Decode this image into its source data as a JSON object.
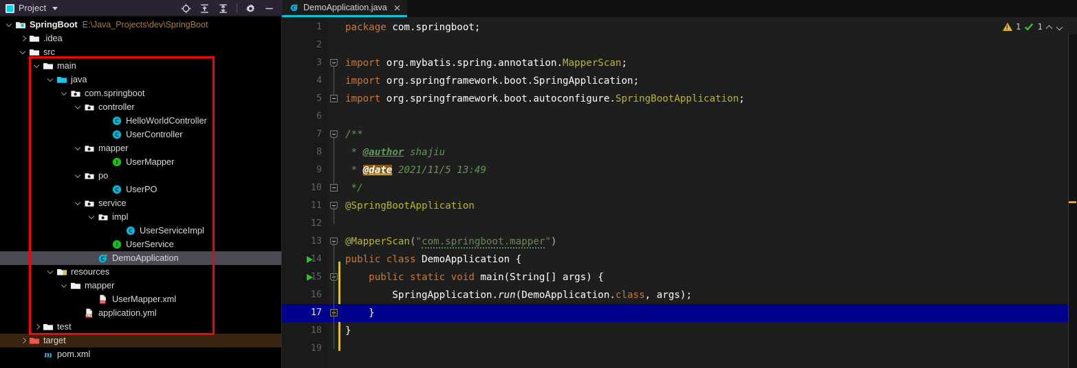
{
  "toolwindow": {
    "title": "Project",
    "project_icon": "project-icon",
    "dropdown_icon": "chevron-down-icon",
    "actions": [
      {
        "name": "locate-icon",
        "label": "Select Opened File"
      },
      {
        "name": "expand-all-icon",
        "label": "Expand All"
      },
      {
        "name": "collapse-all-icon",
        "label": "Collapse All"
      },
      {
        "name": "gear-icon",
        "label": "Settings"
      },
      {
        "name": "minimize-icon",
        "label": "Hide"
      }
    ]
  },
  "tree": {
    "items": [
      {
        "label": "SpringBoot",
        "path": "E:\\Java_Projects\\dev\\SpringBoot",
        "indent": 0,
        "arrow": "down",
        "icon": "module-icon",
        "bold": true,
        "state": "normal"
      },
      {
        "label": ".idea",
        "path": "",
        "indent": 1,
        "arrow": "right",
        "icon": "folder-icon",
        "bold": false,
        "state": "normal"
      },
      {
        "label": "src",
        "path": "",
        "indent": 1,
        "arrow": "down",
        "icon": "folder-icon",
        "bold": false,
        "state": "normal"
      },
      {
        "label": "main",
        "path": "",
        "indent": 2,
        "arrow": "down",
        "icon": "folder-icon",
        "bold": false,
        "state": "normal"
      },
      {
        "label": "java",
        "path": "",
        "indent": 3,
        "arrow": "down",
        "icon": "source-root-icon",
        "bold": false,
        "state": "normal"
      },
      {
        "label": "com.springboot",
        "path": "",
        "indent": 4,
        "arrow": "down",
        "icon": "package-icon",
        "bold": false,
        "state": "normal"
      },
      {
        "label": "controller",
        "path": "",
        "indent": 5,
        "arrow": "down",
        "icon": "package-icon",
        "bold": false,
        "state": "normal"
      },
      {
        "label": "HelloWorldController",
        "path": "",
        "indent": 7,
        "arrow": "none",
        "icon": "java-class-icon",
        "bold": false,
        "state": "normal"
      },
      {
        "label": "UserController",
        "path": "",
        "indent": 7,
        "arrow": "none",
        "icon": "java-class-icon",
        "bold": false,
        "state": "normal"
      },
      {
        "label": "mapper",
        "path": "",
        "indent": 5,
        "arrow": "down",
        "icon": "package-icon",
        "bold": false,
        "state": "normal"
      },
      {
        "label": "UserMapper",
        "path": "",
        "indent": 7,
        "arrow": "none",
        "icon": "java-interface-icon",
        "bold": false,
        "state": "normal"
      },
      {
        "label": "po",
        "path": "",
        "indent": 5,
        "arrow": "down",
        "icon": "package-icon",
        "bold": false,
        "state": "normal"
      },
      {
        "label": "UserPO",
        "path": "",
        "indent": 7,
        "arrow": "none",
        "icon": "java-class-icon",
        "bold": false,
        "state": "normal"
      },
      {
        "label": "service",
        "path": "",
        "indent": 5,
        "arrow": "down",
        "icon": "package-icon",
        "bold": false,
        "state": "normal"
      },
      {
        "label": "impl",
        "path": "",
        "indent": 6,
        "arrow": "down",
        "icon": "package-icon",
        "bold": false,
        "state": "normal"
      },
      {
        "label": "UserServiceImpl",
        "path": "",
        "indent": 8,
        "arrow": "none",
        "icon": "java-class-icon",
        "bold": false,
        "state": "normal"
      },
      {
        "label": "UserService",
        "path": "",
        "indent": 7,
        "arrow": "none",
        "icon": "java-interface-icon",
        "bold": false,
        "state": "normal"
      },
      {
        "label": "DemoApplication",
        "path": "",
        "indent": 6,
        "arrow": "none",
        "icon": "spring-class-icon",
        "bold": false,
        "state": "selected"
      },
      {
        "label": "resources",
        "path": "",
        "indent": 3,
        "arrow": "down",
        "icon": "resource-root-icon",
        "bold": false,
        "state": "normal"
      },
      {
        "label": "mapper",
        "path": "",
        "indent": 4,
        "arrow": "down",
        "icon": "folder-icon",
        "bold": false,
        "state": "normal"
      },
      {
        "label": "UserMapper.xml",
        "path": "",
        "indent": 6,
        "arrow": "none",
        "icon": "xml-file-icon",
        "bold": false,
        "state": "normal"
      },
      {
        "label": "application.yml",
        "path": "",
        "indent": 5,
        "arrow": "none",
        "icon": "yml-file-icon",
        "bold": false,
        "state": "normal"
      },
      {
        "label": "test",
        "path": "",
        "indent": 2,
        "arrow": "right",
        "icon": "folder-icon",
        "bold": false,
        "state": "normal"
      },
      {
        "label": "target",
        "path": "",
        "indent": 1,
        "arrow": "right",
        "icon": "excluded-folder-icon",
        "bold": false,
        "state": "excluded"
      },
      {
        "label": "pom.xml",
        "path": "",
        "indent": 2,
        "arrow": "none",
        "icon": "maven-icon",
        "bold": false,
        "state": "normal"
      }
    ],
    "highlight_box_color": "#ff0000"
  },
  "editor": {
    "tab": {
      "label": "DemoApplication.java",
      "icon": "spring-class-icon",
      "close_icon": "close-icon"
    },
    "inspection": {
      "warning_count": "1",
      "ok_count": "1",
      "warning_icon": "warning-triangle-icon",
      "ok_icon": "checkmark-icon",
      "prev_icon": "chevron-up-icon",
      "next_icon": "chevron-down-icon"
    },
    "current_line": 17,
    "lines": [
      {
        "n": "1",
        "indent": 0
      },
      {
        "n": "2",
        "indent": 0
      },
      {
        "n": "3",
        "indent": 0
      },
      {
        "n": "4",
        "indent": 0
      },
      {
        "n": "5",
        "indent": 0
      },
      {
        "n": "6",
        "indent": 0
      },
      {
        "n": "7",
        "indent": 0
      },
      {
        "n": "8",
        "indent": 0
      },
      {
        "n": "9",
        "indent": 0
      },
      {
        "n": "10",
        "indent": 0
      },
      {
        "n": "11",
        "indent": 0
      },
      {
        "n": "12",
        "indent": 0
      },
      {
        "n": "13",
        "indent": 0
      },
      {
        "n": "14",
        "indent": 0
      },
      {
        "n": "15",
        "indent": 0
      },
      {
        "n": "16",
        "indent": 0
      },
      {
        "n": "17",
        "indent": 0
      },
      {
        "n": "18",
        "indent": 0
      },
      {
        "n": "19",
        "indent": 0
      }
    ],
    "code": [
      "package com.springboot;",
      "",
      "import org.mybatis.spring.annotation.MapperScan;",
      "import org.springframework.boot.SpringApplication;",
      "import org.springframework.boot.autoconfigure.SpringBootApplication;",
      "",
      "/**",
      " * @author shajiu",
      " * @date 2021/11/5 13:49",
      " */",
      "@SpringBootApplication",
      "",
      "@MapperScan(\"com.springboot.mapper\")",
      "public class DemoApplication {",
      "    public static void main(String[] args) {",
      "        SpringApplication.run(DemoApplication.class, args);",
      "    }",
      "}",
      ""
    ],
    "run_marker_lines": [
      "14",
      "15"
    ],
    "colors": {
      "keyword": "#cc7832",
      "string": "#6a8759",
      "comment": "#629755",
      "annotation": "#bbb529",
      "identifier": "#a9b7c6",
      "caret_row": "#00008f",
      "background": "#1e1e1e",
      "gutter": "#1a1a1a"
    }
  }
}
